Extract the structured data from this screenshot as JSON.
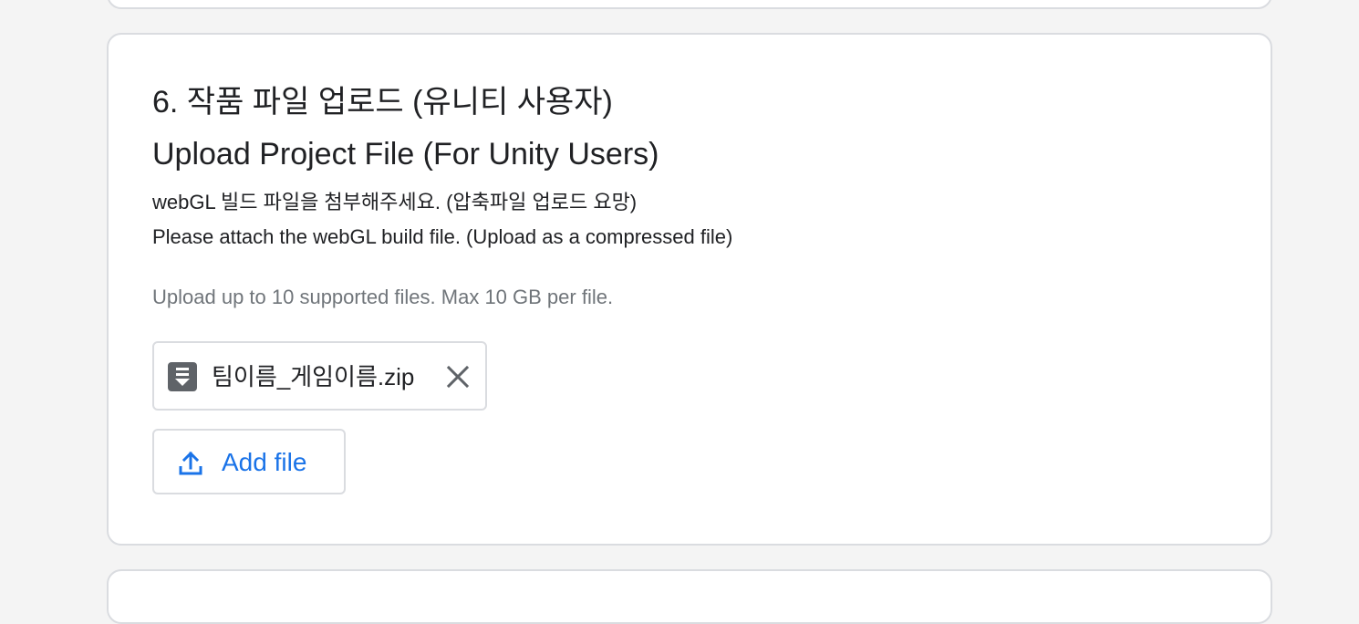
{
  "question": {
    "title_ko": "6. 작품 파일 업로드 (유니티 사용자)",
    "title_en": "Upload Project File (For Unity Users)",
    "description_ko": "webGL 빌드 파일을 첨부해주세요. (압축파일 업로드 요망)",
    "description_en": "Please attach the webGL build file. (Upload as a compressed file)",
    "upload_hint": "Upload up to 10 supported files. Max 10 GB per file."
  },
  "uploaded_file": {
    "name": "팀이름_게임이름.zip",
    "icon": "zip-file-icon",
    "remove_icon": "close-icon"
  },
  "add_file_button": {
    "label": "Add file",
    "icon": "upload-icon"
  },
  "colors": {
    "accent": "#1a73e8",
    "page_background": "#f4f4f4",
    "card_border": "#dadce0",
    "hint_text": "#70757a"
  }
}
